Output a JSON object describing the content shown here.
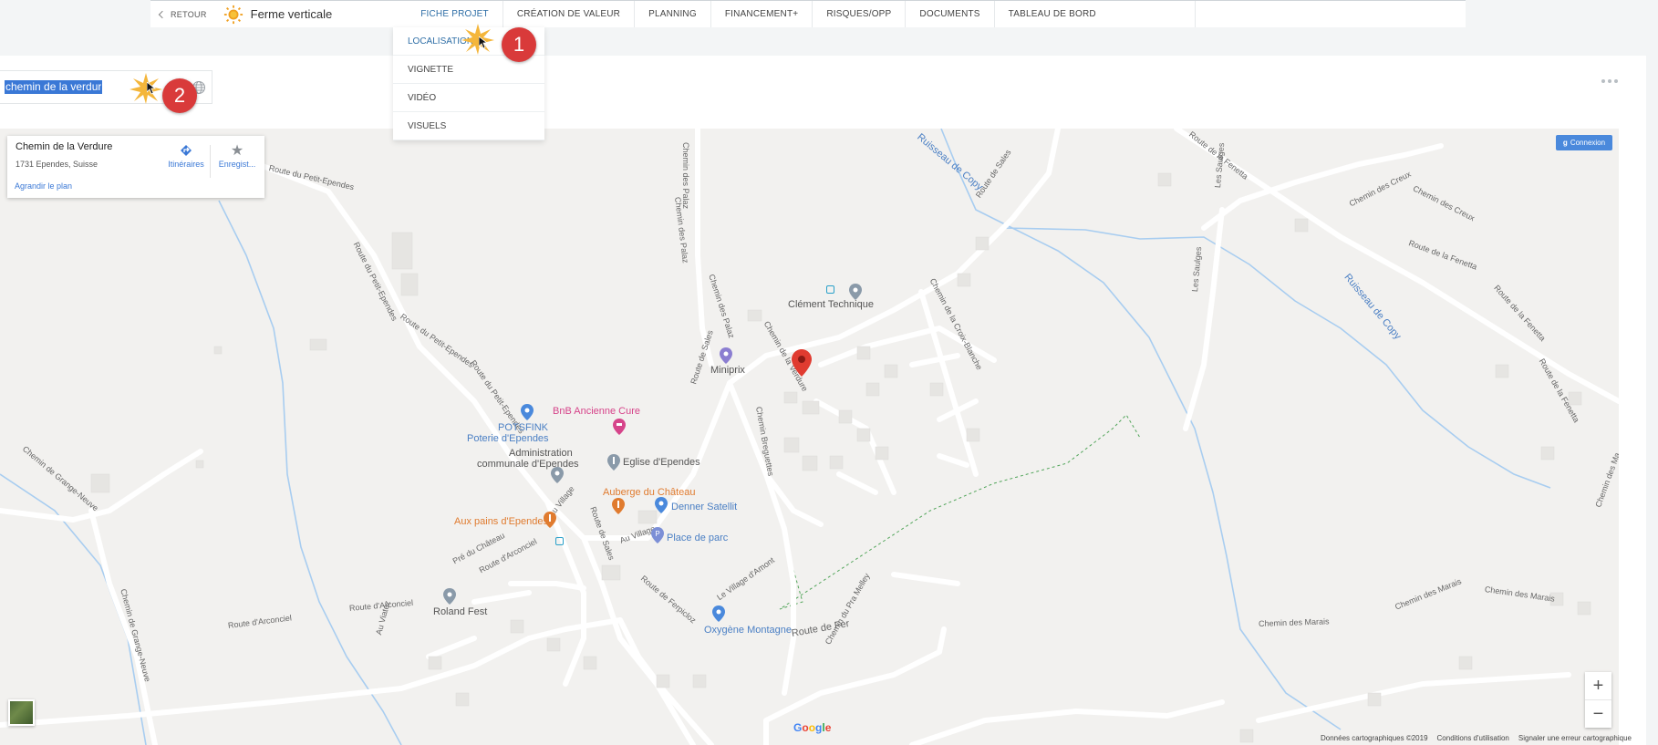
{
  "topbar": {
    "back_label": "RETOUR",
    "project_name": "Ferme verticale",
    "tabs": [
      "FICHE PROJET",
      "CRÉATION DE VALEUR",
      "PLANNING",
      "FINANCEMENT+",
      "RISQUES/OPP",
      "DOCUMENTS",
      "TABLEAU DE BORD"
    ]
  },
  "dropdown": {
    "items": [
      "LOCALISATION",
      "VIGNETTE",
      "VIDÉO",
      "VISUELS"
    ]
  },
  "search": {
    "value": "chemin de la verdure"
  },
  "callouts": {
    "one": "1",
    "two": "2"
  },
  "infocard": {
    "name": "Chemin de la Verdure",
    "address": "1731 Ependes, Suisse",
    "directions": "Itinéraires",
    "save": "Enregist...",
    "enlarge": "Agrandir le plan"
  },
  "map": {
    "connexion": "Connexion",
    "attribution": [
      "Données cartographiques ©2019",
      "Conditions d'utilisation",
      "Signaler une erreur cartographique"
    ],
    "google": "Google",
    "zoom_in": "+",
    "zoom_out": "−",
    "roads": {
      "r1": "Route du Petit-Ependes",
      "r2": "Route du Petit-Ependes",
      "r3": "Route du Petit-Ependes",
      "r4": "Route du Petit-Ependes",
      "r5": "Chemin des Palaz",
      "r6": "Chemin des Palaz",
      "r7": "Chemin des Palaz",
      "r8": "Route de Sales",
      "r9": "Route de Sales",
      "r10": "Chemin de la Verdure",
      "r11": "Chemin de la Croix-Blanche",
      "r12": "Chemin des Creux",
      "r13": "Chemin des Creux",
      "r14": "Route de la Fenetta",
      "r15": "Route de la Fenetta",
      "r16": "Route de la Fenetta",
      "r17": "Route de la Fenetta",
      "r18": "Les Saulges",
      "r19": "Les Saulges",
      "r20": "Ruisseau de Copy",
      "r21": "Ruisseau de Copy",
      "r22": "Chemin de Grange-Neuve",
      "r23": "Chemin de Grange-Neuve",
      "r24": "Route d'Arconciel",
      "r25": "Route d'Arconciel",
      "r26": "Route d'Arconciel",
      "r27": "Route de Ferpicloz",
      "r28": "Route de Sales",
      "r29": "Au Village",
      "r30": "Au Village",
      "r31": "Pré du Château",
      "r32": "Le Village d'Amont",
      "r33": "Chemin du Pra Melley",
      "r34": "Chemin des Marais",
      "r35": "Chemin des Marais",
      "r36": "Chemin des Marais",
      "r37": "Route de Fer",
      "r38": "Au Viatoz",
      "r39": "Chemin Breguettes",
      "r40": "Chemin des Ma"
    },
    "pois": {
      "clement": "Clément Technique",
      "miniprix": "Miniprix",
      "bnb": "BnB Ancienne Cure",
      "potsfink1": "POTSFINK",
      "potsfink2": "Poterie d'Ependes",
      "admin1": "Administration",
      "admin2": "communale d'Ependes",
      "eglise": "Eglise d'Ependes",
      "auberge": "Auberge du Château",
      "denner": "Denner Satellit",
      "auxpains": "Aux pains d'Ependes",
      "parc": "Place de parc",
      "roland": "Roland Fest",
      "oxygene": "Oxygène Montagne"
    },
    "colors": {
      "road": "#ffffff",
      "water": "#a8cdf0",
      "poi_blue": "#4a7fc4",
      "poi_pink": "#d6448a",
      "poi_orange": "#e07b2f",
      "marker": "#e03b30"
    }
  }
}
